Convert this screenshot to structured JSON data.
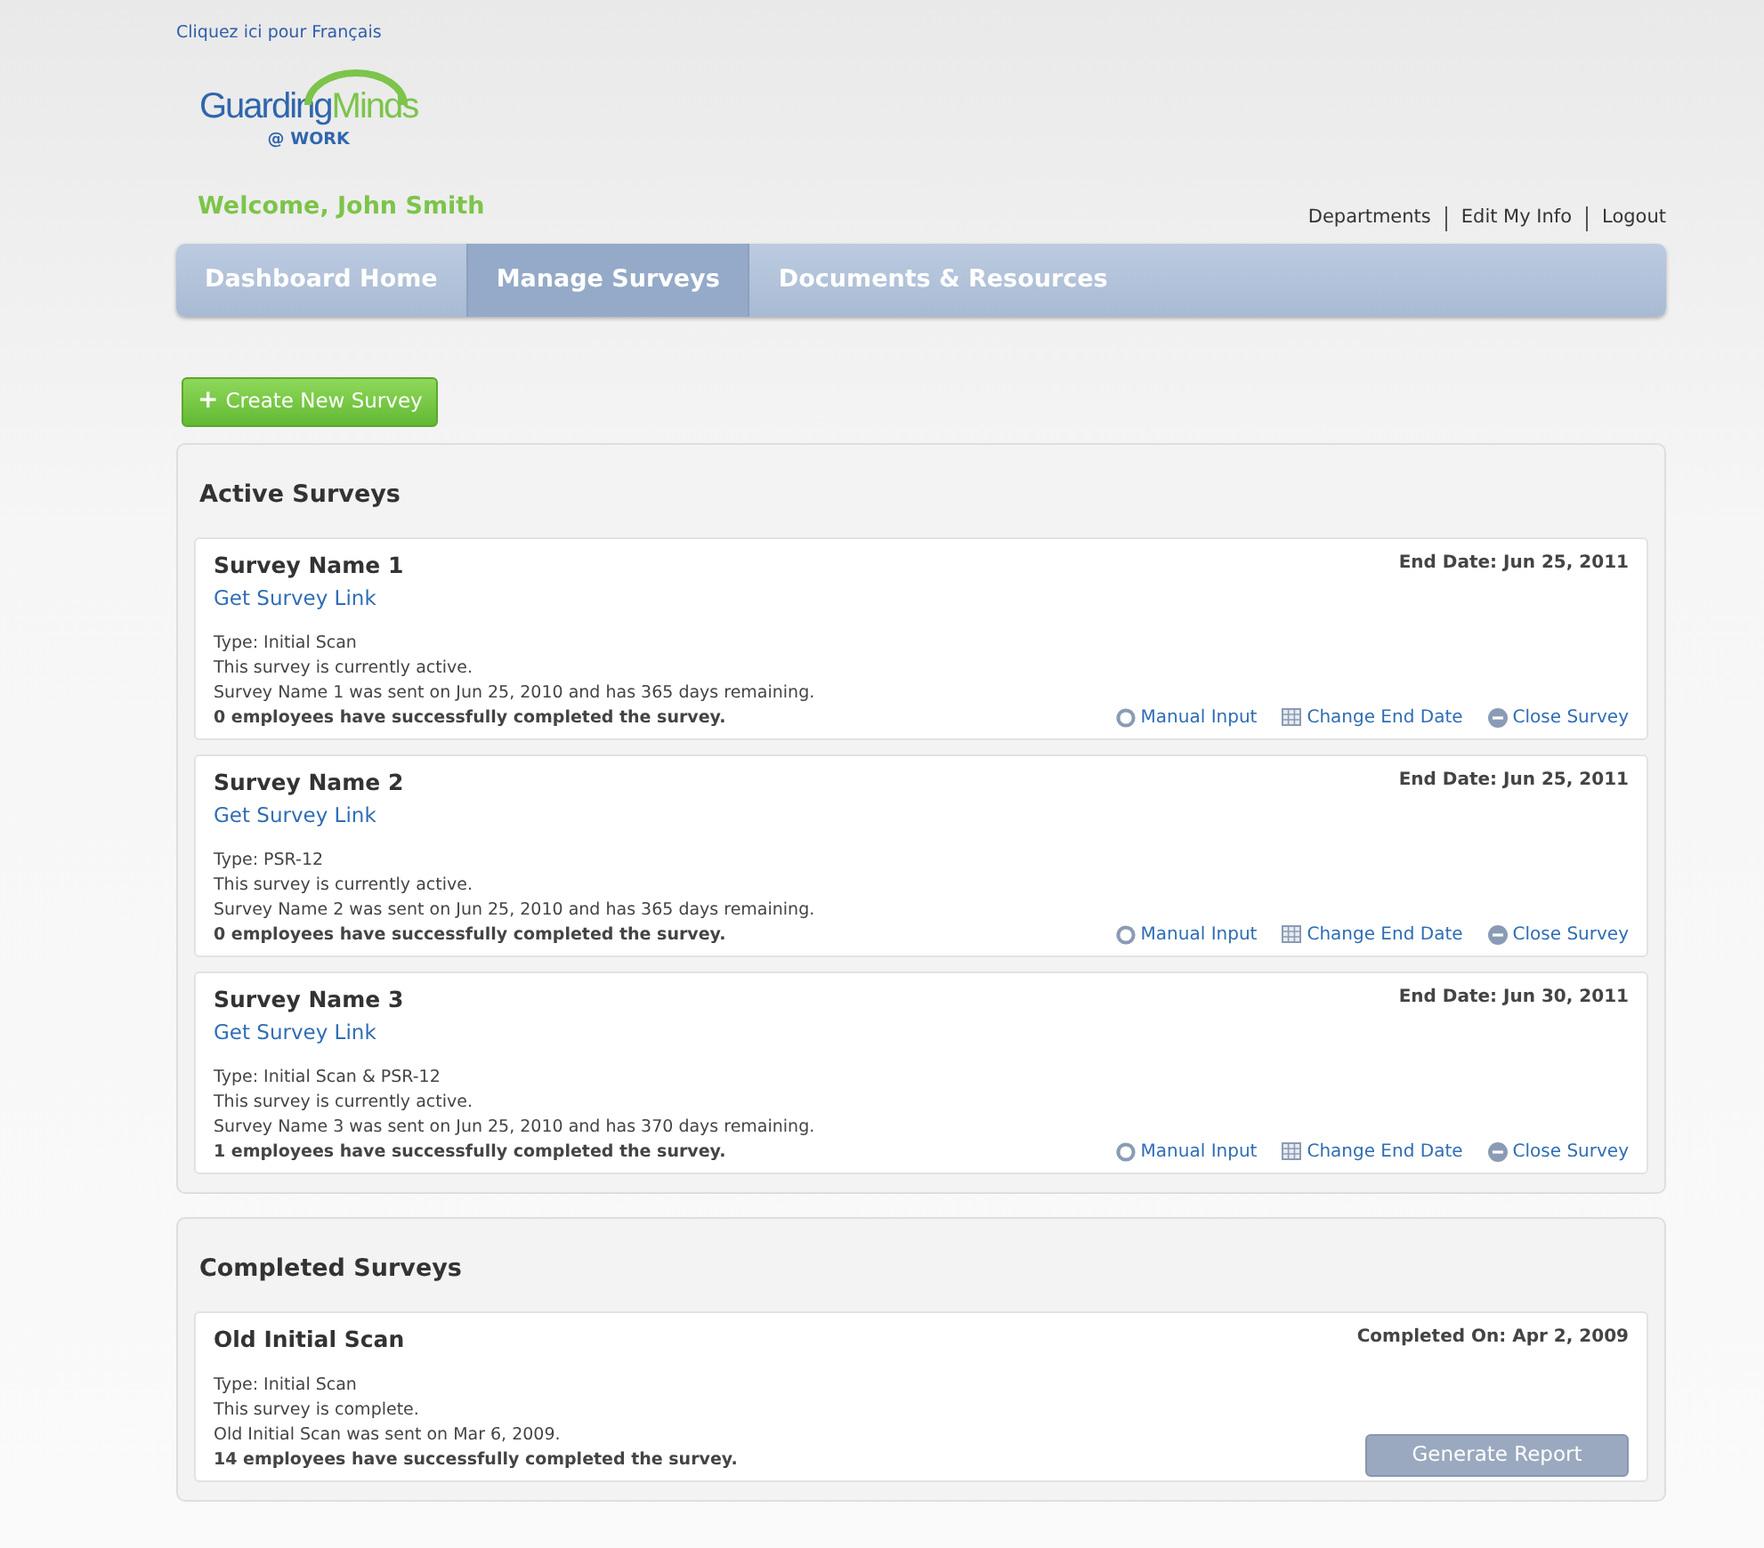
{
  "language_link": "Cliquez ici pour Français",
  "logo": {
    "first": "Guarding",
    "second": "Minds",
    "tagline": "@ WORK"
  },
  "welcome": "Welcome, John Smith",
  "user_links": [
    "Departments",
    "Edit My Info",
    "Logout"
  ],
  "nav_tabs": [
    {
      "label": "Dashboard Home",
      "selected": false
    },
    {
      "label": "Manage Surveys",
      "selected": true
    },
    {
      "label": "Documents & Resources",
      "selected": false
    }
  ],
  "create_button": {
    "icon": "+",
    "label": "Create New Survey"
  },
  "active_surveys": {
    "title": "Active Surveys",
    "surveys": [
      {
        "name": "Survey Name 1",
        "link": "Get Survey Link",
        "date": "End Date: Jun 25, 2011",
        "lines": [
          "Type: Initial Scan",
          "This survey is currently active.",
          "Survey Name 1 was sent on Jun 25, 2010 and has 365 days remaining."
        ],
        "completed": "0 employees have successfully completed the survey.",
        "actions": [
          {
            "kind": "manual",
            "label": "Manual Input"
          },
          {
            "kind": "calendar",
            "label": "Change End Date"
          },
          {
            "kind": "close",
            "label": "Close Survey"
          }
        ]
      },
      {
        "name": "Survey Name 2",
        "link": "Get Survey Link",
        "date": "End Date: Jun 25, 2011",
        "lines": [
          "Type: PSR-12",
          "This survey is currently active.",
          "Survey Name 2 was sent on Jun 25, 2010 and has 365 days remaining."
        ],
        "completed": "0 employees have successfully completed the survey.",
        "actions": [
          {
            "kind": "manual",
            "label": "Manual Input"
          },
          {
            "kind": "calendar",
            "label": "Change End Date"
          },
          {
            "kind": "close",
            "label": "Close Survey"
          }
        ]
      },
      {
        "name": "Survey Name 3",
        "link": "Get Survey Link",
        "date": "End Date: Jun 30, 2011",
        "lines": [
          "Type: Initial Scan & PSR-12",
          "This survey is currently active.",
          "Survey Name 3 was sent on Jun 25, 2010 and has 370 days remaining."
        ],
        "completed": "1 employees have successfully completed the survey.",
        "actions": [
          {
            "kind": "manual",
            "label": "Manual Input"
          },
          {
            "kind": "calendar",
            "label": "Change End Date"
          },
          {
            "kind": "close",
            "label": "Close Survey"
          }
        ]
      }
    ]
  },
  "completed_surveys": {
    "title": "Completed Surveys",
    "surveys": [
      {
        "name": "Old Initial Scan",
        "date": "Completed On: Apr 2, 2009",
        "lines": [
          "Type: Initial Scan",
          "This survey is complete.",
          "Old Initial Scan was sent on Mar 6, 2009."
        ],
        "completed": "14 employees have successfully completed the survey.",
        "button": "Generate Report"
      }
    ]
  }
}
